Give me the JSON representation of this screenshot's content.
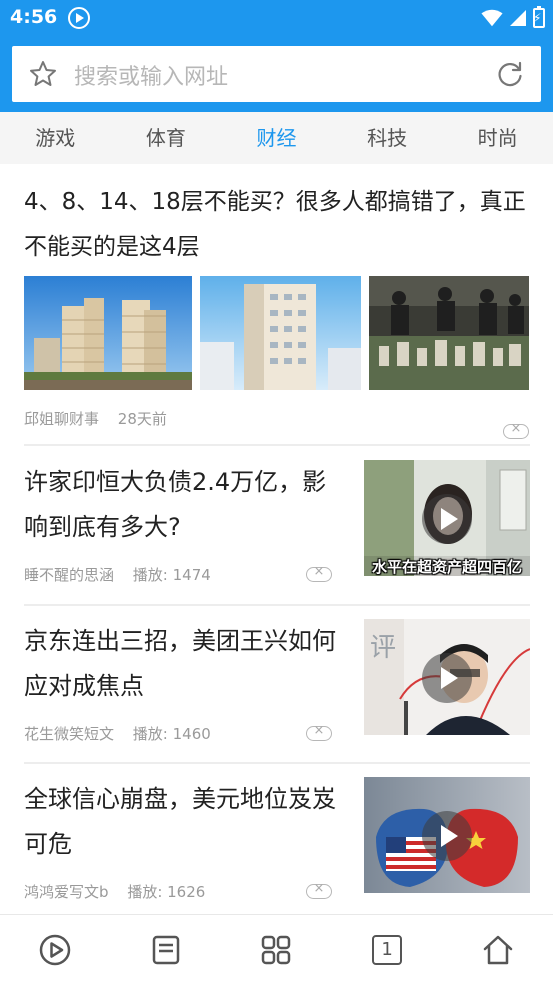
{
  "status_bar": {
    "time": "4:56",
    "icons": [
      "media-play-icon",
      "wifi-icon",
      "signal-icon",
      "battery-charging-icon"
    ]
  },
  "search": {
    "placeholder": "搜索或输入网址",
    "left_icon": "star-icon",
    "right_icon": "refresh-icon"
  },
  "tabs": [
    {
      "label": "游戏",
      "active": false
    },
    {
      "label": "体育",
      "active": false
    },
    {
      "label": "财经",
      "active": true
    },
    {
      "label": "科技",
      "active": false
    },
    {
      "label": "时尚",
      "active": false
    }
  ],
  "feed": {
    "featured": {
      "title": "4、8、14、18层不能买？很多人都搞错了，真正不能买的是这4层",
      "source": "邱姐聊财事",
      "time": "28天前",
      "image_count": 3
    },
    "items": [
      {
        "title": "许家印恒大负债2.4万亿，影响到底有多大?",
        "source": "睡不醒的思涵",
        "plays": "播放: 1474",
        "thumb_caption": "水平在超资产超四百亿"
      },
      {
        "title": "京东连出三招，美团王兴如何应对成焦点",
        "source": "花生微笑短文",
        "plays": "播放: 1460",
        "thumb_caption": "评"
      },
      {
        "title": "全球信心崩盘，美元地位岌岌可危",
        "source": "鸿鸿爱写文b",
        "plays": "播放: 1626",
        "thumb_caption": ""
      }
    ]
  },
  "bottom_nav": {
    "items": [
      "video-play-icon",
      "news-icon",
      "apps-grid-icon",
      "tabs-counter-icon",
      "home-icon"
    ],
    "tab_count": "1"
  },
  "colors": {
    "brand": "#1d97ee",
    "tab_active": "#1d97ee",
    "tab_bar_bg": "#f5f5f5",
    "meta_text": "#9a9a9a"
  }
}
